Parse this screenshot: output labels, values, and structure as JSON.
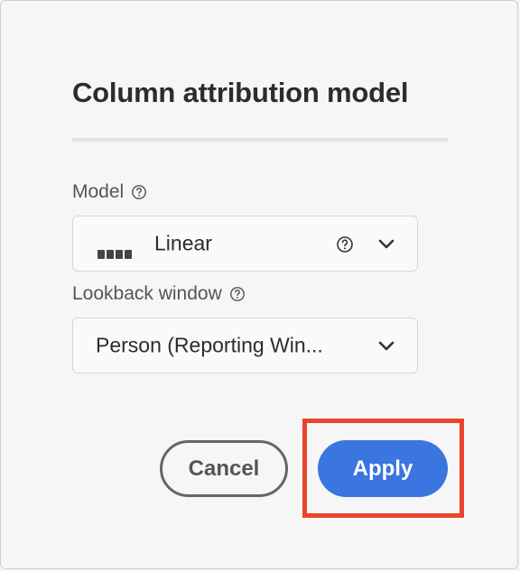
{
  "dialog": {
    "title": "Column attribution model"
  },
  "model": {
    "label": "Model",
    "value": "Linear",
    "value_icon": "linear-bars-icon"
  },
  "lookback": {
    "label": "Lookback window",
    "value": "Person (Reporting Win..."
  },
  "actions": {
    "cancel_label": "Cancel",
    "apply_label": "Apply"
  },
  "colors": {
    "accent": "#3a75e0",
    "highlight": "#e8452a",
    "text": "#2c2c2c"
  }
}
